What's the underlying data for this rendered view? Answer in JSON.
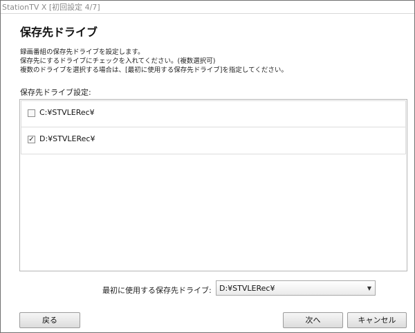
{
  "window": {
    "title": "StationTV X [初回設定 4/7]"
  },
  "page": {
    "heading": "保存先ドライブ",
    "description": [
      "録画番組の保存先ドライブを設定します。",
      "保存先にするドライブにチェックを入れてください。(複数選択可)",
      "複数のドライブを選択する場合は、[最初に使用する保存先ドライブ]を指定してください。"
    ],
    "section_label": "保存先ドライブ設定:"
  },
  "drives": [
    {
      "path": "C:¥STVLERec¥",
      "checked": false
    },
    {
      "path": "D:¥STVLERec¥",
      "checked": true
    }
  ],
  "first_drive": {
    "label": "最初に使用する保存先ドライブ:",
    "selected": "D:¥STVLERec¥"
  },
  "buttons": {
    "back": "戻る",
    "next": "次へ",
    "cancel": "キャンセル"
  }
}
